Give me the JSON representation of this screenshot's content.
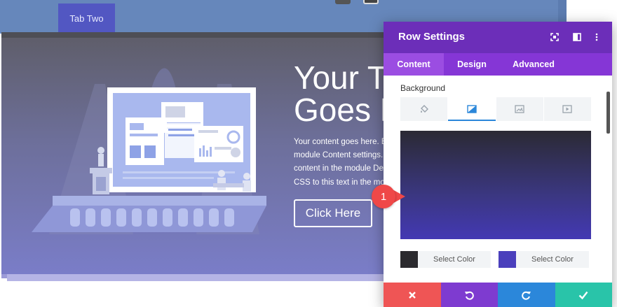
{
  "page": {
    "tab_label": "Tab Two",
    "hero_title_line1": "Your T",
    "hero_title_line2": "Goes H",
    "hero_body_lines": [
      "Your content goes here. Edit or remove this text inline or in the",
      "module Content settings. You can also style every aspect of this",
      "content in the module Design settings and even apply custom",
      "CSS to this text in the module Advanced settings."
    ],
    "hero_button": "Click Here"
  },
  "modal": {
    "title": "Row Settings",
    "header_icons": [
      "fullscreen-icon",
      "split-view-icon",
      "more-options-icon"
    ],
    "tabs": [
      {
        "label": "Content",
        "active": true
      },
      {
        "label": "Design",
        "active": false
      },
      {
        "label": "Advanced",
        "active": false
      }
    ],
    "background_label": "Background",
    "background_types": [
      "color-fill-icon",
      "gradient-icon",
      "image-icon",
      "video-icon"
    ],
    "active_background_type": "gradient-icon",
    "gradient": {
      "start_color": "#2b2a34",
      "end_color": "#4338b3"
    },
    "color_pickers": [
      {
        "swatch": "#2b2a2e",
        "label": "Select Color"
      },
      {
        "swatch": "#4a3fbc",
        "label": "Select Color"
      }
    ],
    "footer_buttons": [
      {
        "name": "discard-icon",
        "color": "#ef5555"
      },
      {
        "name": "undo-icon",
        "color": "#7e3bd0"
      },
      {
        "name": "redo-icon",
        "color": "#2b87da"
      },
      {
        "name": "save-icon",
        "color": "#29c4a9"
      }
    ]
  },
  "annotation": {
    "number": "1"
  },
  "colors": {
    "header_purple": "#6c2eb9",
    "tab_purple": "#8536d6",
    "accent_blue": "#2b87da",
    "marker_red": "#ef4848"
  }
}
